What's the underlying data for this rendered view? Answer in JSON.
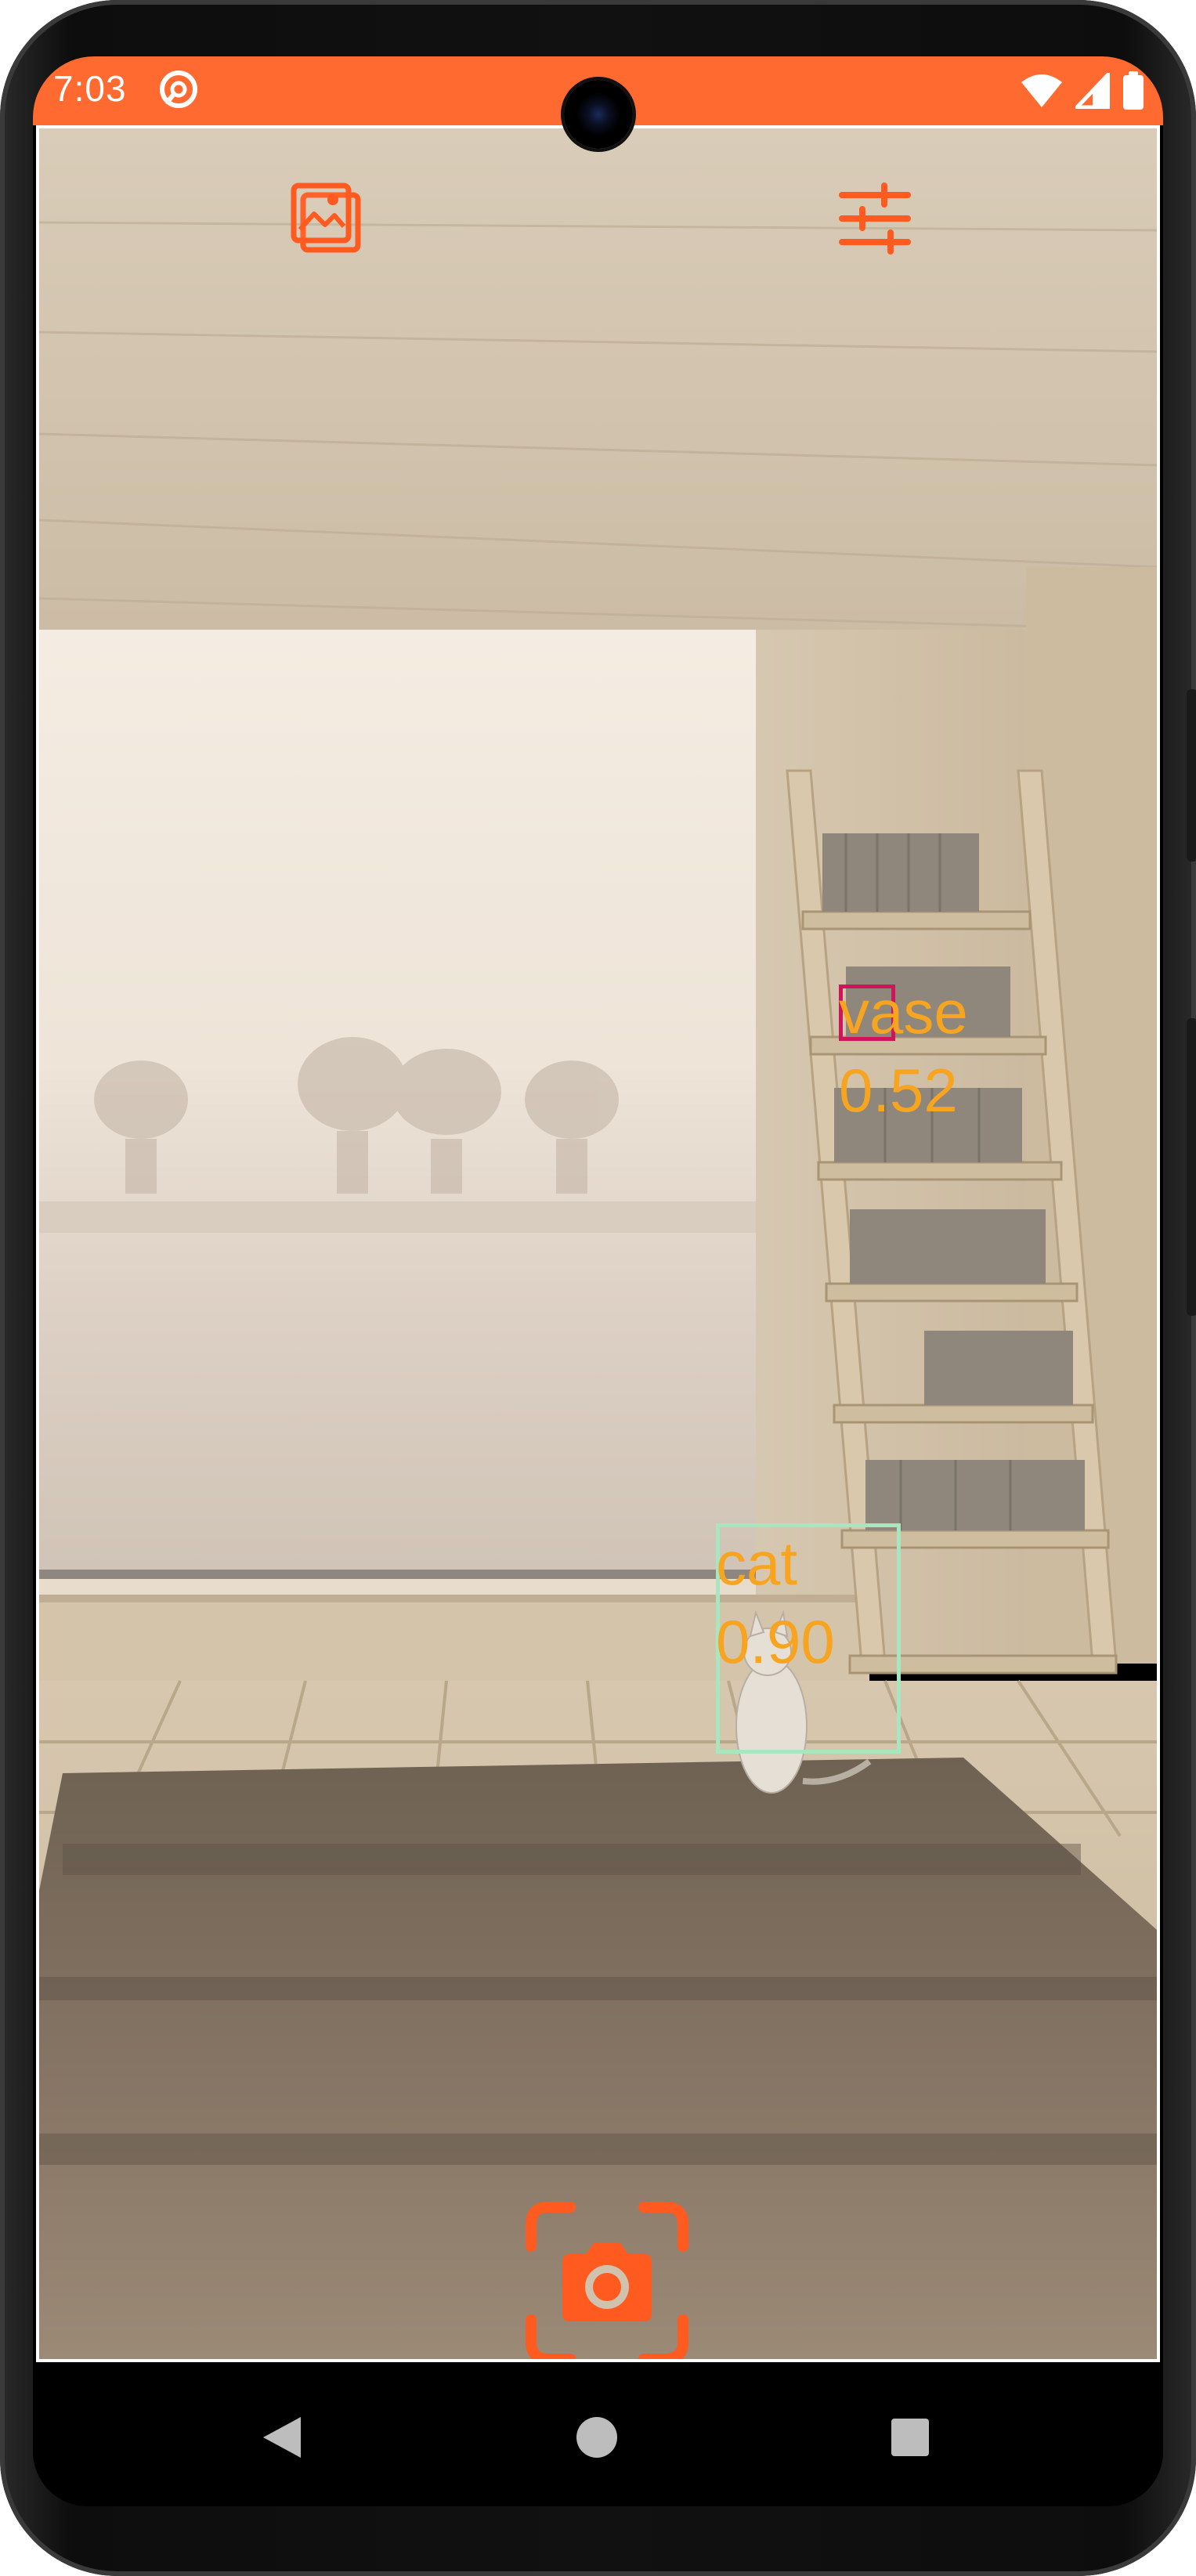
{
  "status_bar": {
    "time": "7:03",
    "background": "#ff6a30",
    "icons": [
      "app-notification-icon",
      "wifi-icon",
      "cellular-signal-icon",
      "battery-icon"
    ]
  },
  "toolbar": {
    "gallery_icon": "gallery-icon",
    "settings_icon": "tune-sliders-icon",
    "accent": "#ff5a1f"
  },
  "detections": [
    {
      "label": "vase",
      "score": "0.52",
      "box_color": "#d0145a",
      "label_color": "#f7a420"
    },
    {
      "label": "cat",
      "score": "0.90",
      "box_color": "#a8e6c0",
      "label_color": "#f7a420"
    }
  ],
  "capture": {
    "icon": "camera-capture-icon",
    "accent": "#ff5a1f"
  },
  "navigation": {
    "icons": [
      "back-triangle-icon",
      "home-circle-icon",
      "recents-square-icon"
    ]
  }
}
